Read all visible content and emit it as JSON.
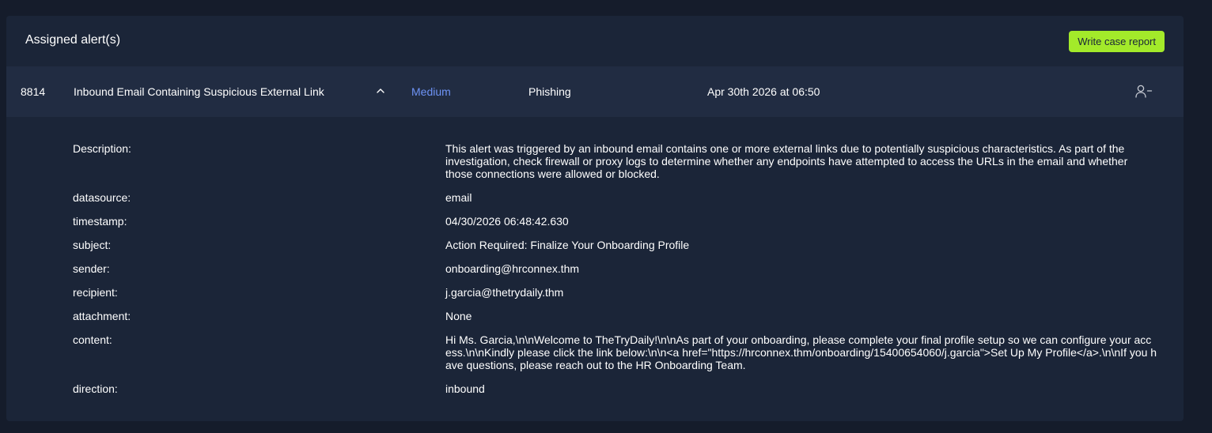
{
  "panel": {
    "title": "Assigned alert(s)",
    "write_report_label": "Write case report"
  },
  "alert": {
    "id": "8814",
    "title": "Inbound Email Containing Suspicious External Link",
    "severity": "Medium",
    "type": "Phishing",
    "date": "Apr 30th 2026 at 06:50",
    "expand_icon": "chevron-up-icon",
    "unassign_icon": "user-minus-icon",
    "severity_color": "#6e93f5"
  },
  "details": [
    {
      "key": "Description:",
      "value": "This alert was triggered by an inbound email contains one or more external links due to potentially suspicious characteristics. As part of the investigation, check firewall or proxy logs to determine whether any endpoints have attempted to access the URLs in the email and whether those connections were allowed or blocked."
    },
    {
      "key": "datasource:",
      "value": "email"
    },
    {
      "key": "timestamp:",
      "value": "04/30/2026 06:48:42.630"
    },
    {
      "key": "subject:",
      "value": "Action Required: Finalize Your Onboarding Profile"
    },
    {
      "key": "sender:",
      "value": "onboarding@hrconnex.thm"
    },
    {
      "key": "recipient:",
      "value": "j.garcia@thetrydaily.thm"
    },
    {
      "key": "attachment:",
      "value": "None"
    },
    {
      "key": "content:",
      "value": "Hi Ms. Garcia,\\n\\nWelcome to TheTryDaily!\\n\\nAs part of your onboarding, please complete your final profile setup so we can configure your access.\\n\\nKindly please click the link below:\\n\\n<a href=\"https://hrconnex.thm/onboarding/15400654060/j.garcia\">Set Up My Profile</a>.\\n\\nIf you have questions, please reach out to the HR Onboarding Team."
    },
    {
      "key": "direction:",
      "value": "inbound"
    }
  ],
  "colors": {
    "page_bg": "#151c2b",
    "panel_bg": "#1b2538",
    "row_bg": "#212c42",
    "accent_button": "#a3ea2a"
  }
}
